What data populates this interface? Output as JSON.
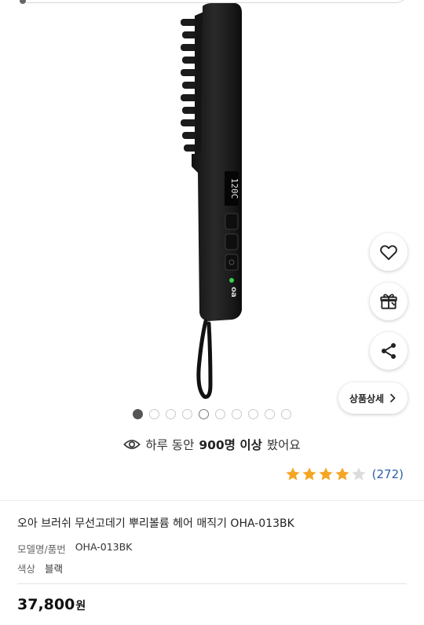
{
  "gallery": {
    "image_alt": "OHA-013BK brush straightener",
    "display_text": "120C",
    "total_slides": 10,
    "active_slide": 1,
    "current_outline_slide": 5
  },
  "actions": {
    "wishlist_icon": "heart-icon",
    "gift_icon": "gift-icon",
    "share_icon": "share-icon",
    "detail_label": "상품상세",
    "detail_icon": "chevron-right-icon"
  },
  "viewers": {
    "prefix": "하루 동안",
    "highlight": "900명 이상",
    "suffix": "봤어요",
    "icon": "eye-icon"
  },
  "rating": {
    "stars": 4,
    "max": 5,
    "count_text": "(272)",
    "star_color": "#f5a623",
    "empty_star_color": "#dcdcdc"
  },
  "product": {
    "name": "오아 브러쉬 무선고데기 뿌리볼륨 헤어 매직기 OHA-013BK",
    "model_label": "모델명/품번",
    "model_value": "OHA-013BK",
    "color_label": "색상",
    "color_value": "블랙",
    "price": "37,800",
    "currency": "원"
  },
  "colors": {
    "link": "#2c5fa8",
    "device": "#1c1c1c"
  }
}
